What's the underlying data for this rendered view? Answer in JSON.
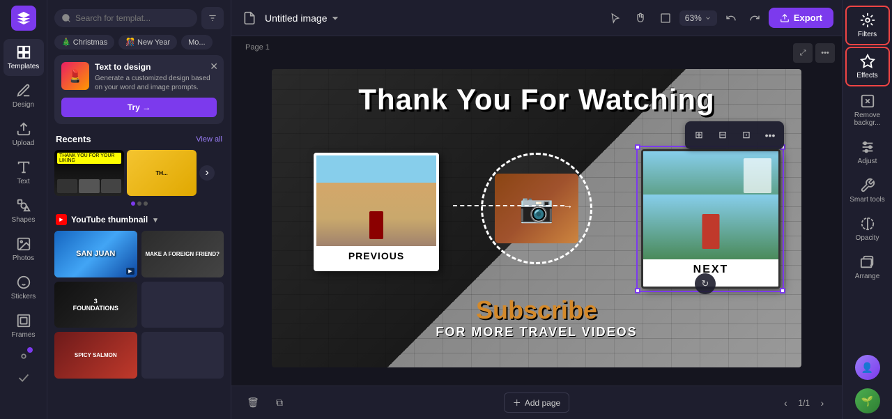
{
  "app": {
    "logo": "✦",
    "title": "Untitled image"
  },
  "sidebar": {
    "items": [
      {
        "id": "templates",
        "label": "Templates",
        "active": true
      },
      {
        "id": "design",
        "label": "Design",
        "active": false
      },
      {
        "id": "upload",
        "label": "Upload",
        "active": false
      },
      {
        "id": "text",
        "label": "Text",
        "active": false
      },
      {
        "id": "shapes",
        "label": "Shapes",
        "active": false
      },
      {
        "id": "photos",
        "label": "Photos",
        "active": false
      },
      {
        "id": "stickers",
        "label": "Stickers",
        "active": false
      },
      {
        "id": "frames",
        "label": "Frames",
        "active": false
      }
    ]
  },
  "panel": {
    "search_placeholder": "Search for templat...",
    "tags": [
      "🎄 Christmas",
      "🎊 New Year",
      "Mo..."
    ],
    "promo": {
      "title": "Text to design",
      "description": "Generate a customized design based on your word and image prompts.",
      "cta": "Try →"
    },
    "recents_label": "Recents",
    "view_all": "View all",
    "section_label": "YouTube thumbnail",
    "thumbnails": [
      {
        "label": "SAN JUAN",
        "class": "thumb-sanjuan"
      },
      {
        "label": "MAKE A FOREIGN FRIEND?",
        "class": "thumb-foreign"
      },
      {
        "label": "3 FOUNDATIONS",
        "class": "thumb-foundations"
      },
      {
        "label": "",
        "class": "thumb-blank"
      },
      {
        "label": "SPICY SALMON",
        "class": "thumb-spicy"
      },
      {
        "label": "",
        "class": "thumb-blank2"
      }
    ]
  },
  "topbar": {
    "zoom": "63%",
    "export_label": "Export"
  },
  "canvas": {
    "page_label": "Page 1",
    "page_fraction": "1/1",
    "title": "Thank You For Watching",
    "prev_label": "PREVIOUS",
    "next_label": "NEXT",
    "subscribe_line1": "Subscribe",
    "subscribe_line2": "FOR MORE TRAVEL VIDEOS"
  },
  "right_sidebar": {
    "items": [
      {
        "id": "filters",
        "label": "Filters",
        "active": true
      },
      {
        "id": "effects",
        "label": "Effects",
        "active": true
      },
      {
        "id": "remove-bg",
        "label": "Remove backgr...",
        "active": false
      },
      {
        "id": "adjust",
        "label": "Adjust",
        "active": false
      },
      {
        "id": "smart-tools",
        "label": "Smart tools",
        "active": false
      },
      {
        "id": "opacity",
        "label": "Opacity",
        "active": false
      },
      {
        "id": "arrange",
        "label": "Arrange",
        "active": false
      }
    ]
  },
  "bottom": {
    "add_page": "Add page"
  }
}
